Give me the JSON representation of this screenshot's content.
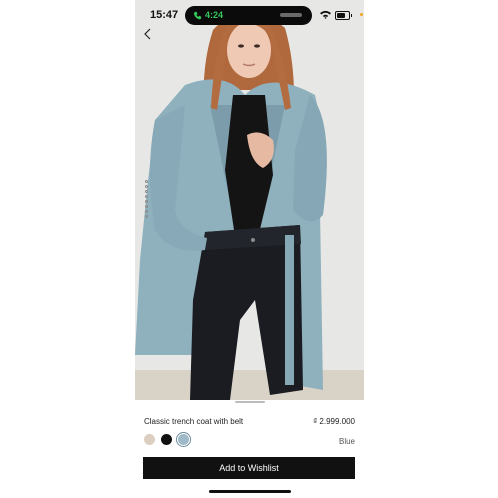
{
  "status_bar": {
    "time": "15:47",
    "call_time": "4:24"
  },
  "icons": {
    "back": "chevron-left-icon",
    "call": "phone-icon",
    "wifi": "wifi-icon",
    "battery": "battery-icon"
  },
  "product": {
    "name": "Classic trench coat with belt",
    "price": "₫ 2.999.000",
    "selected_color": "Blue",
    "swatches": [
      {
        "name": "beige",
        "color": "#dccfc2"
      },
      {
        "name": "black",
        "color": "#111111"
      },
      {
        "name": "blue",
        "color": "#9fb9c9",
        "selected": true
      }
    ]
  },
  "actions": {
    "wishlist_label": "Add to Wishlist"
  }
}
